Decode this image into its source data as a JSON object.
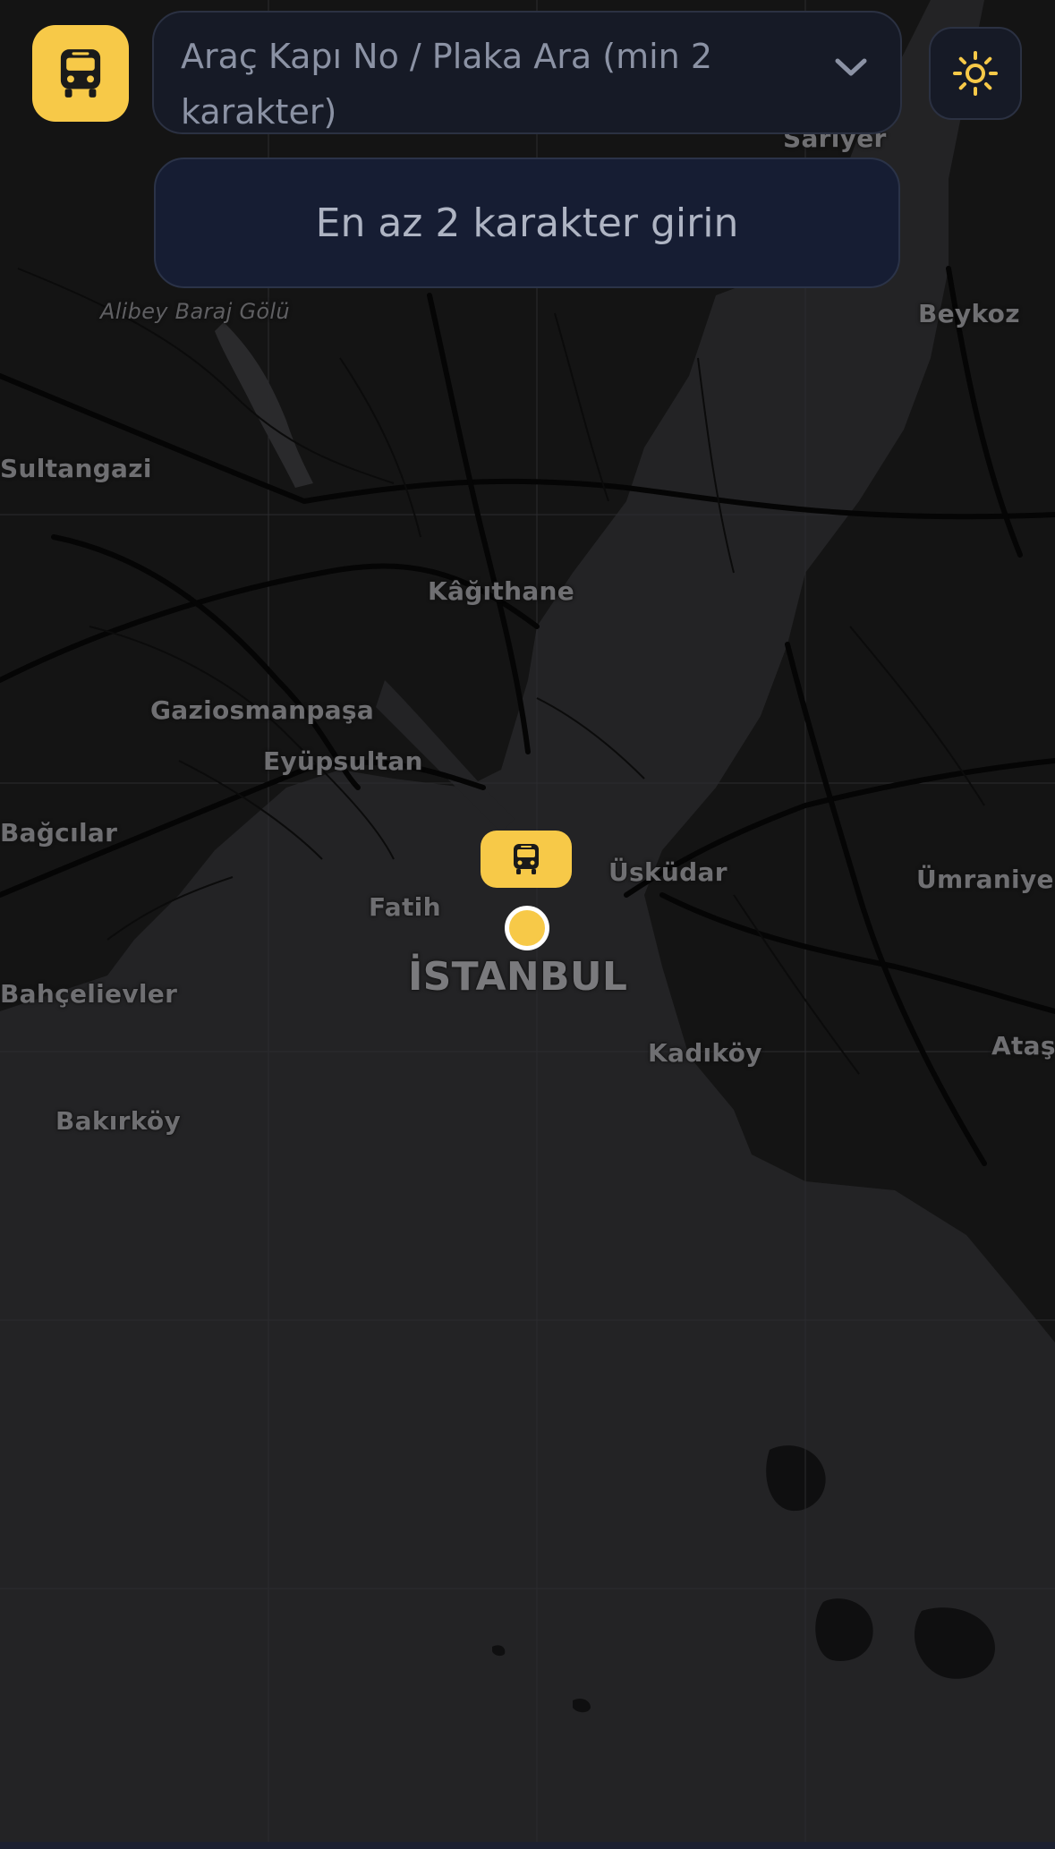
{
  "header": {
    "logo_icon": "bus-icon",
    "search_placeholder": "Araç Kapı No / Plaka Ara (min 2 karakter)",
    "dropdown_icon": "chevron-down-icon",
    "theme_icon": "sun-icon"
  },
  "hint": {
    "text": "En az 2 karakter girin"
  },
  "map": {
    "places": {
      "sariyer": "Sarıyer",
      "alibey": "Alibey Baraj Gölü",
      "beykoz": "Beykoz",
      "sultangazi": "Sultangazi",
      "kagithane": "Kâğıthane",
      "gaziosmanpasa": "Gaziosmanpaşa",
      "eyupsultan": "Eyüpsultan",
      "bagcilar": "Bağcılar",
      "uskudar": "Üsküdar",
      "umraniye": "Ümraniye",
      "fatih": "Fatih",
      "istanbul": "İSTANBUL",
      "bahcelievler": "Bahçelievler",
      "kadikoy": "Kadıköy",
      "atasehir": "Ataş",
      "bakirkoy": "Bakırköy"
    },
    "vehicle_marker_icon": "bus-icon",
    "location_marker": "current-location-dot"
  },
  "colors": {
    "accent": "#f7c948",
    "land": "#141414",
    "water": "#232325",
    "panel": "#161a26"
  }
}
